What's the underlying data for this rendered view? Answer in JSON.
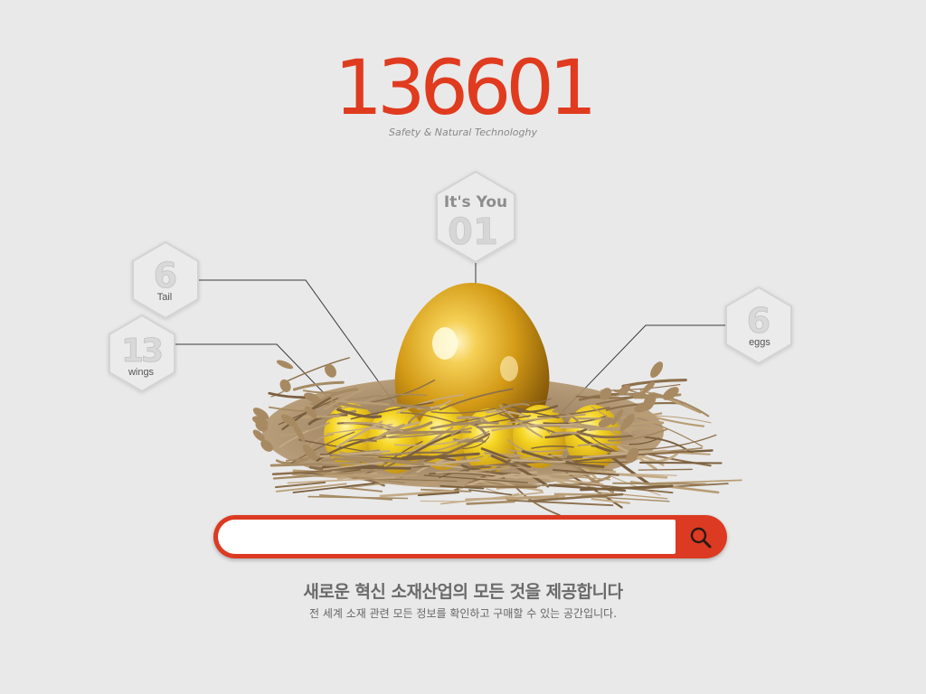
{
  "brand": {
    "logo": "136601",
    "tagline": "Safety & Natural Technologhy"
  },
  "badges": {
    "center": {
      "top_text": "It's You",
      "number": "01"
    },
    "tail": {
      "number": "6",
      "label": "Tail"
    },
    "wings": {
      "number": "13",
      "label": "wings"
    },
    "eggs": {
      "number": "6",
      "label": "eggs"
    }
  },
  "search": {
    "value": "",
    "placeholder": ""
  },
  "footer": {
    "headline": "새로운 혁신 소재산업의 모든 것을 제공합니다",
    "subline": "전 세계 소재 관련 모든 정보를 확인하고 구매할 수 있는 공간입니다."
  },
  "colors": {
    "background": "#e9e9e9",
    "accent": "#e03b1f",
    "gold": "#d9a21a",
    "yellow_egg": "#f3cf1c",
    "nest": "#a98a62"
  }
}
